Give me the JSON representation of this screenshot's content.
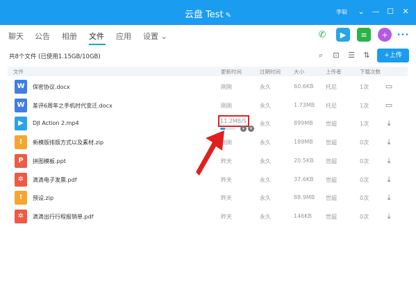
{
  "window": {
    "title": "云盘 Test",
    "edit_glyph": "✎",
    "user": "李聪",
    "controls": [
      "⌄",
      "—",
      "☐",
      "✕"
    ]
  },
  "nav": {
    "tabs": [
      {
        "label": "聊天"
      },
      {
        "label": "公告"
      },
      {
        "label": "相册"
      },
      {
        "label": "文件"
      },
      {
        "label": "应用"
      },
      {
        "label": "设置 ⌄"
      }
    ],
    "active_index": 3,
    "right_icons": [
      "phone-icon",
      "video-call-icon",
      "notes-icon",
      "apps-icon",
      "more-icon"
    ],
    "more_glyph": "•••"
  },
  "toolbar": {
    "file_count": "共8个文件 (已使用1.15GB/10GB)",
    "upload_label": "+上传",
    "icons": [
      "search-icon",
      "inbox-icon",
      "list-view-icon",
      "sort-icon"
    ]
  },
  "table": {
    "headers": [
      "文件",
      "更新时间",
      "过期时间",
      "大小",
      "上传者",
      "下载次数"
    ],
    "rows": [
      {
        "name": "保密协议.docx",
        "updated": "刚刚",
        "expires": "永久",
        "size": "60.6KB",
        "uploader": "托尼",
        "downloads": "1次",
        "type": "word",
        "glyph": "W",
        "action": "folder-icon",
        "action_glyph": "▭"
      },
      {
        "name": "差评6周年之手机时代变迁.docx",
        "updated": "刚刚",
        "expires": "永久",
        "size": "1.73MB",
        "uploader": "托尼",
        "downloads": "1次",
        "type": "word",
        "glyph": "W",
        "action": "folder-icon",
        "action_glyph": "▭"
      },
      {
        "name": "DJI Action 2.mp4",
        "updated": "",
        "expires": "永久",
        "size": "899MB",
        "uploader": "世超",
        "downloads": "1次",
        "type": "video",
        "glyph": "▶",
        "action": "download-icon",
        "action_glyph": "⤓"
      },
      {
        "name": "新模版排版方式以及素材.zip",
        "updated": "刚刚",
        "expires": "永久",
        "size": "189MB",
        "uploader": "世超",
        "downloads": "0次",
        "type": "zip",
        "glyph": "!",
        "action": "download-icon",
        "action_glyph": "⤓"
      },
      {
        "name": "拼图模板.ppt",
        "updated": "昨天",
        "expires": "永久",
        "size": "20.5KB",
        "uploader": "世超",
        "downloads": "0次",
        "type": "ppt",
        "glyph": "P",
        "action": "download-icon",
        "action_glyph": "⤓"
      },
      {
        "name": "滴滴电子发票.pdf",
        "updated": "昨天",
        "expires": "永久",
        "size": "37.6KB",
        "uploader": "世超",
        "downloads": "0次",
        "type": "pdf",
        "glyph": "✲",
        "action": "download-icon",
        "action_glyph": "⤓"
      },
      {
        "name": "预设.zip",
        "updated": "昨天",
        "expires": "永久",
        "size": "88.9MB",
        "uploader": "世超",
        "downloads": "0次",
        "type": "zip",
        "glyph": "!",
        "action": "download-icon",
        "action_glyph": "⤓"
      },
      {
        "name": "滴滴出行行程报销单.pdf",
        "updated": "昨天",
        "expires": "永久",
        "size": "146KB",
        "uploader": "世超",
        "downloads": "0次",
        "type": "pdf",
        "glyph": "✲",
        "action": "download-icon",
        "action_glyph": "⤓"
      }
    ]
  },
  "upload_progress": {
    "speed": "11.2MB/S",
    "progress_fraction": 0.3,
    "pause_glyph": "⏸",
    "cancel_glyph": "✕"
  },
  "colors": {
    "accent": "#1a9cf0",
    "word": "#3f7ee6",
    "video": "#2aa3e8",
    "zip": "#f6a630",
    "ppt": "#ef5a45",
    "pdf": "#ef5a45",
    "highlight": "#e02020"
  }
}
